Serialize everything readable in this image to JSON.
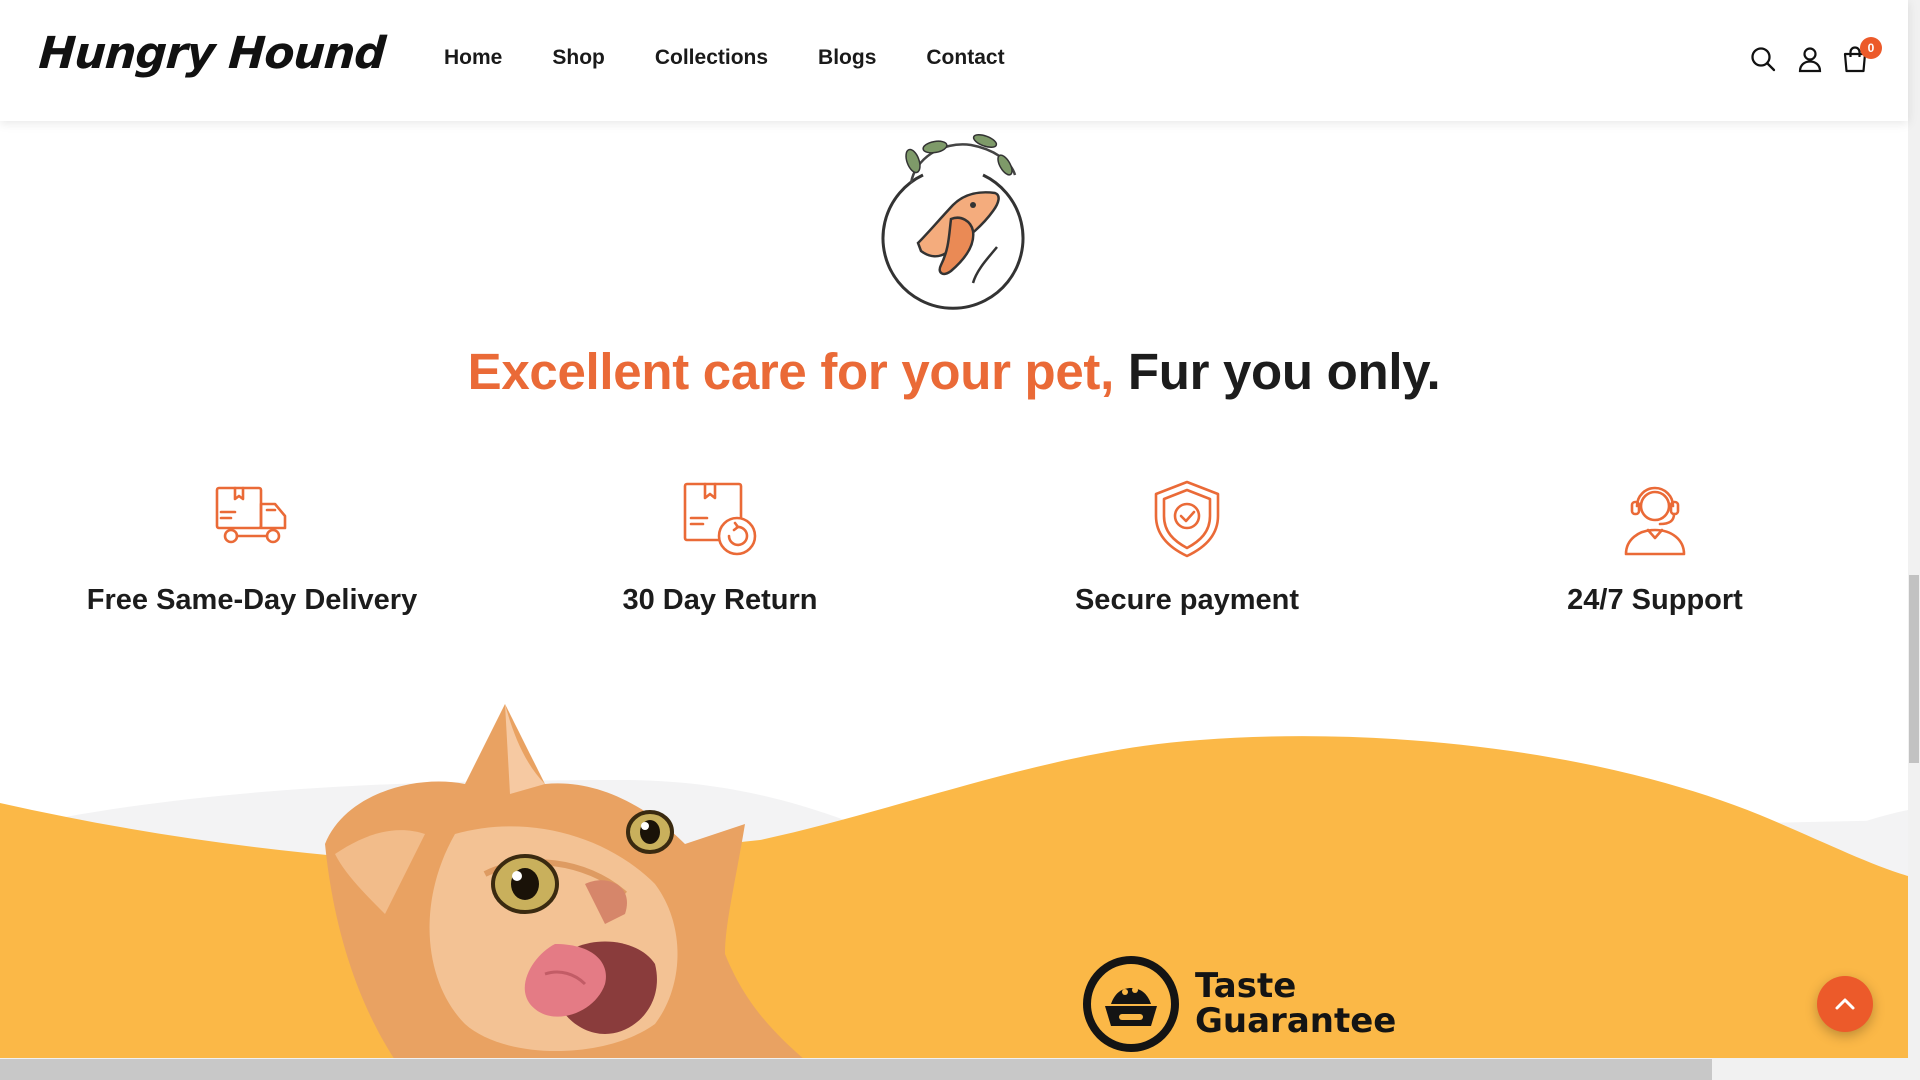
{
  "header": {
    "logo": "Hungry Hound",
    "nav": [
      "Home",
      "Shop",
      "Collections",
      "Blogs",
      "Contact"
    ],
    "cart_count": "0",
    "icons": [
      "search-icon",
      "user-icon",
      "cart-icon"
    ]
  },
  "hero": {
    "tagline_accent": "Excellent care for your pet,",
    "tagline_rest": "Fur you only."
  },
  "features": [
    {
      "label": "Free Same-Day Delivery",
      "icon": "delivery-truck-icon"
    },
    {
      "label": "30 Day Return",
      "icon": "return-box-icon"
    },
    {
      "label": "Secure payment",
      "icon": "shield-check-icon"
    },
    {
      "label": "24/7 Support",
      "icon": "support-agent-icon"
    }
  ],
  "promo": {
    "line1": "Taste",
    "line2": "Guarantee",
    "icon": "food-bowl-icon"
  },
  "colors": {
    "accent": "#ea6a37",
    "wave_yellow": "#fbb847",
    "dark": "#1c1c1c"
  }
}
